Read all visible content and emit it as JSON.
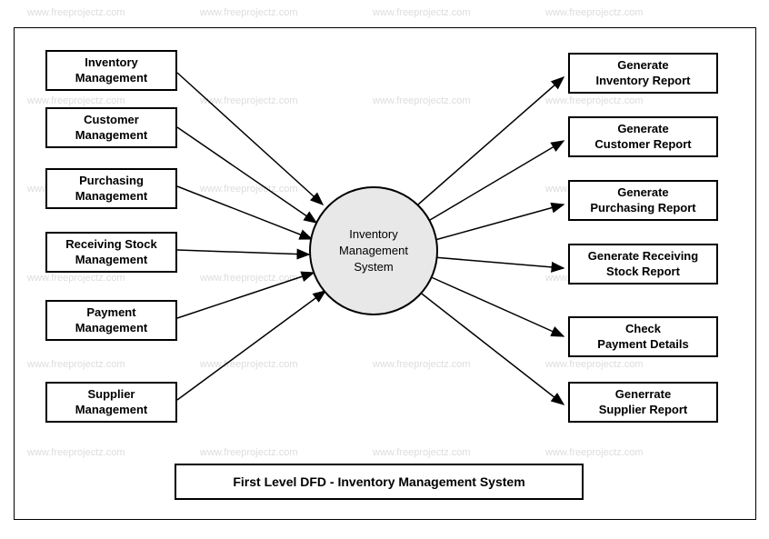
{
  "watermark": "www.freeprojectz.com",
  "center": {
    "label": "Inventory\nManagement\nSystem"
  },
  "left_boxes": [
    {
      "label": "Inventory\nManagement"
    },
    {
      "label": "Customer\nManagement"
    },
    {
      "label": "Purchasing\nManagement"
    },
    {
      "label": "Receiving Stock\nManagement"
    },
    {
      "label": "Payment\nManagement"
    },
    {
      "label": "Supplier\nManagement"
    }
  ],
  "right_boxes": [
    {
      "label": "Generate\nInventory Report"
    },
    {
      "label": "Generate\nCustomer Report"
    },
    {
      "label": "Generate\nPurchasing Report"
    },
    {
      "label": "Generate Receiving\nStock Report"
    },
    {
      "label": "Check\nPayment Details"
    },
    {
      "label": "Generrate\nSupplier Report"
    }
  ],
  "title": "First Level DFD - Inventory Management System"
}
